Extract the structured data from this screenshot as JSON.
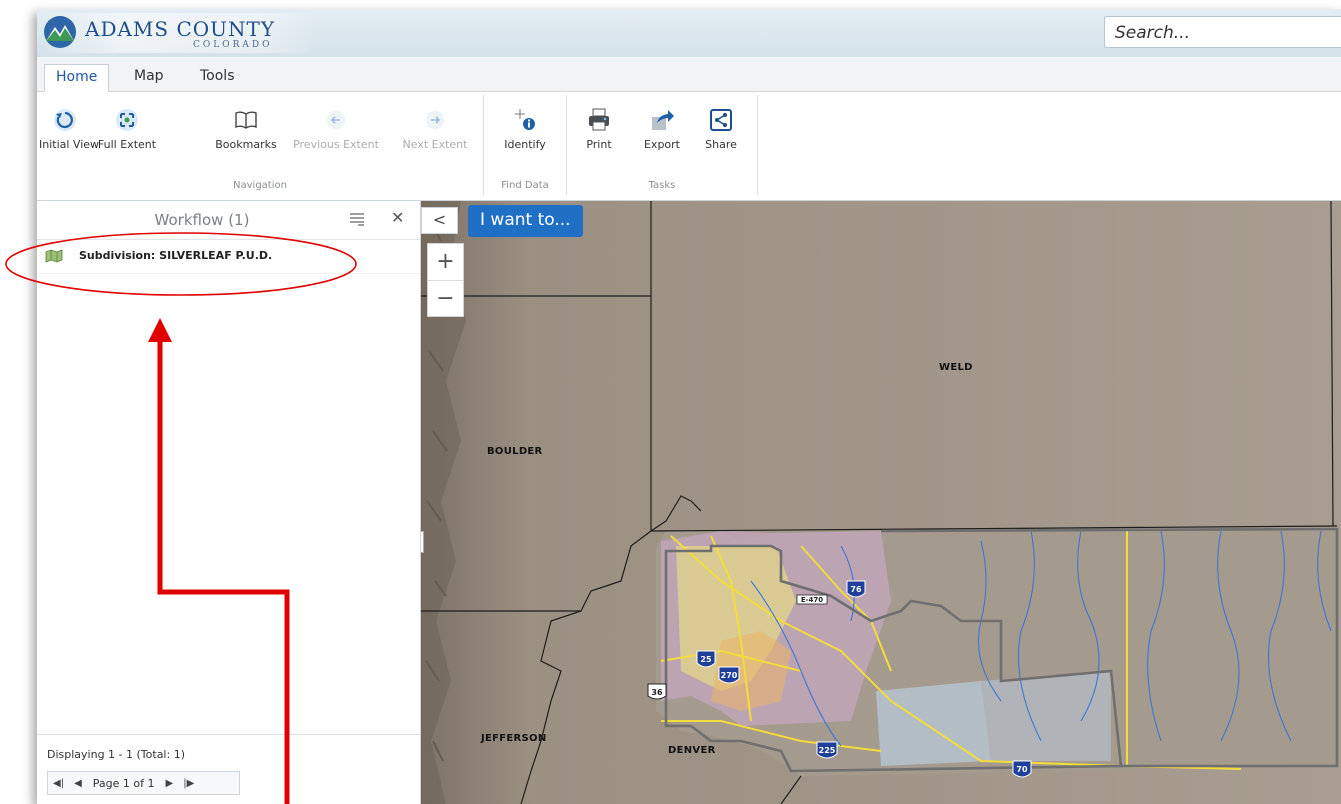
{
  "header": {
    "logo_title": "ADAMS COUNTY",
    "logo_subtitle": "COLORADO",
    "search_placeholder": "Search..."
  },
  "tabs": [
    {
      "label": "Home",
      "active": true
    },
    {
      "label": "Map",
      "active": false
    },
    {
      "label": "Tools",
      "active": false
    }
  ],
  "ribbon": {
    "navigation": {
      "label": "Navigation",
      "initial_view": "Initial View",
      "full_extent": "Full Extent",
      "bookmarks": "Bookmarks",
      "previous_extent": "Previous Extent",
      "next_extent": "Next Extent"
    },
    "find_data": {
      "label": "Find Data",
      "identify": "Identify"
    },
    "tasks": {
      "label": "Tasks",
      "print": "Print",
      "export": "Export",
      "share": "Share"
    }
  },
  "panel": {
    "title": "Workflow (1)",
    "result_label": "Subdivision: SILVERLEAF P.U.D.",
    "footer_text": "Displaying 1 - 1 (Total: 1)",
    "pager_text": "Page 1 of 1"
  },
  "map": {
    "i_want_to": "I want to...",
    "zoom_in": "+",
    "zoom_out": "−",
    "collapse": "<",
    "counties": {
      "weld": "WELD",
      "boulder": "BOULDER",
      "jefferson": "JEFFERSON",
      "denver": "DENVER"
    },
    "shields": {
      "i76": "76",
      "i25": "25",
      "i270": "270",
      "i225": "225",
      "i70": "70",
      "us36": "36",
      "e470": "E-470"
    }
  },
  "colors": {
    "accent": "#1f6fc5",
    "brand": "#1f4e8c",
    "annotation": "#e00000",
    "map_base": "#a19689"
  }
}
